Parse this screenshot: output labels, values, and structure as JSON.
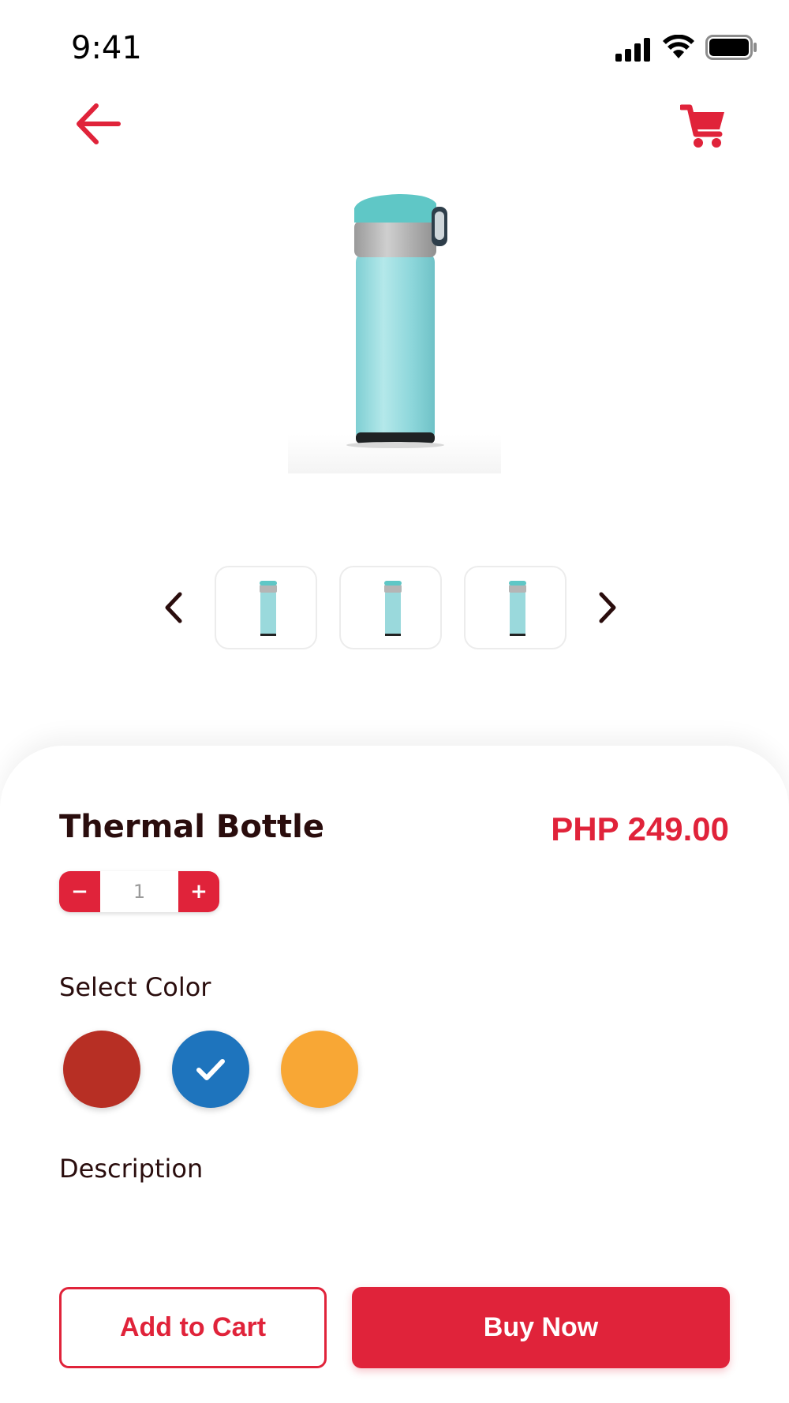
{
  "status_bar": {
    "time": "9:41",
    "icons": [
      "cellular-signal-icon",
      "wifi-icon",
      "battery-icon"
    ]
  },
  "nav": {
    "back_icon": "arrow-left-icon",
    "cart_icon": "shopping-cart-icon"
  },
  "gallery": {
    "prev_icon": "chevron-left-icon",
    "next_icon": "chevron-right-icon",
    "thumbnails": [
      "thumbnail-1",
      "thumbnail-2",
      "thumbnail-3"
    ]
  },
  "product": {
    "name": "Thermal Bottle",
    "price": "PHP 249.00",
    "quantity": {
      "decrement_label": "−",
      "value": "1",
      "increment_label": "+"
    }
  },
  "colors": {
    "label": "Select Color",
    "swatches": [
      {
        "name": "red",
        "hex": "#b72f24",
        "selected": false
      },
      {
        "name": "blue",
        "hex": "#1e74bd",
        "selected": true
      },
      {
        "name": "orange",
        "hex": "#f8a735",
        "selected": false
      }
    ]
  },
  "description": {
    "label": "Description"
  },
  "actions": {
    "add_to_cart": "Add to Cart",
    "buy_now": "Buy Now"
  },
  "theme": {
    "accent": "#e0233a",
    "text_dark": "#2a0d0d"
  }
}
